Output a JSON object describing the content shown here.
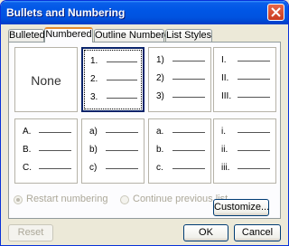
{
  "window": {
    "title": "Bullets and Numbering"
  },
  "tabs": [
    {
      "label": "Bulleted"
    },
    {
      "label": "Numbered"
    },
    {
      "label": "Outline Numbered"
    },
    {
      "label": "List Styles"
    }
  ],
  "active_tab": "Numbered",
  "gallery": {
    "none_label": "None",
    "styles": [
      {
        "markers": []
      },
      {
        "markers": [
          "1.",
          "2.",
          "3."
        ]
      },
      {
        "markers": [
          "1)",
          "2)",
          "3)"
        ]
      },
      {
        "markers": [
          "I.",
          "II.",
          "III."
        ]
      },
      {
        "markers": [
          "A.",
          "B.",
          "C."
        ]
      },
      {
        "markers": [
          "a)",
          "b)",
          "c)"
        ]
      },
      {
        "markers": [
          "a.",
          "b.",
          "c."
        ]
      },
      {
        "markers": [
          "i.",
          "ii.",
          "iii."
        ]
      }
    ],
    "selected_index": 1
  },
  "options": {
    "restart": "Restart numbering",
    "continue": "Continue previous list"
  },
  "buttons": {
    "customize": "Customize...",
    "reset": "Reset",
    "ok": "OK",
    "cancel": "Cancel"
  }
}
